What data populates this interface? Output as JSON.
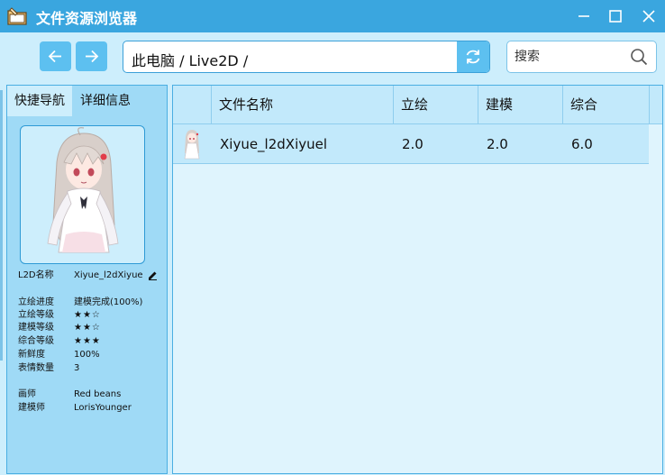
{
  "window": {
    "title": "文件资源浏览器",
    "controls": [
      "minimize",
      "maximize",
      "close"
    ]
  },
  "toolbar": {
    "back_icon": "arrow-left-icon",
    "forward_icon": "arrow-right-icon",
    "address": "此电脑 / Live2D /",
    "refresh_icon": "refresh-icon",
    "search_placeholder": "搜索",
    "search_value": ""
  },
  "left_panel": {
    "tabs": [
      {
        "label": "快捷导航",
        "active": false
      },
      {
        "label": "详细信息",
        "active": true
      }
    ],
    "model_name_label": "L2D名称",
    "model_name_value": "Xiyue_l2dXiyue",
    "details": [
      {
        "label": "立绘进度",
        "value": "建模完成(100%)"
      },
      {
        "label": "立绘等级",
        "value": "★★☆"
      },
      {
        "label": "建模等级",
        "value": "★★☆"
      },
      {
        "label": "综合等级",
        "value": "★★★"
      },
      {
        "label": "新鲜度",
        "value": "100%"
      },
      {
        "label": "表情数量",
        "value": "3"
      }
    ],
    "credits": [
      {
        "label": "画师",
        "value": "Red beans"
      },
      {
        "label": "建模师",
        "value": "LorisYounger"
      }
    ]
  },
  "table": {
    "columns": [
      "文件名称",
      "立绘",
      "建模",
      "综合"
    ],
    "rows": [
      {
        "name": "Xiyue_l2dXiyuel",
        "art": "2.0",
        "model": "2.0",
        "overall": "6.0"
      }
    ]
  },
  "colors": {
    "accent": "#3aa6df",
    "button": "#5dc0f0",
    "panel": "#9fdaf6",
    "background": "#cdeefc"
  }
}
